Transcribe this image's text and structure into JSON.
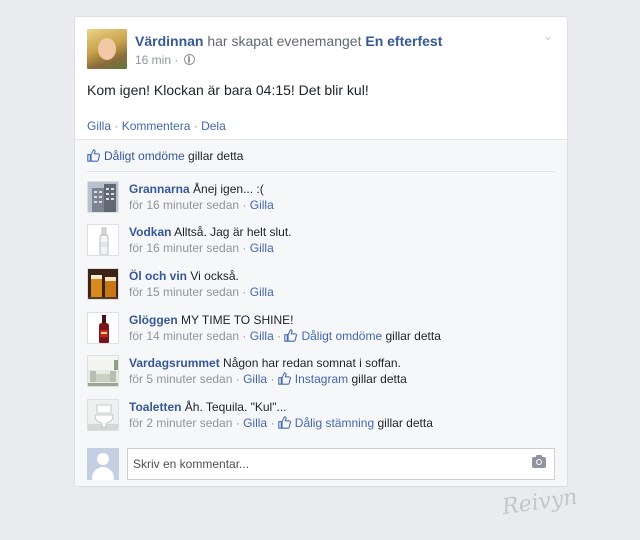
{
  "post": {
    "author": "Värdinnan",
    "action_text": "har skapat evenemanget",
    "event_name": "En efterfest",
    "time": "16 min",
    "text": "Kom igen! Klockan är bara 04:15! Det blir kul!",
    "actions": {
      "like": "Gilla",
      "comment": "Kommentera",
      "share": "Dela"
    },
    "separator": "·"
  },
  "likes": {
    "liker": "Dåligt omdöme",
    "suffix": "gillar detta"
  },
  "comments": [
    {
      "name": "Grannarna",
      "text": "Ånej igen... :(",
      "time": "för 16 minuter sedan",
      "like": "Gilla",
      "icon": "building-icon"
    },
    {
      "name": "Vodkan",
      "text": "Alltså. Jag är helt slut.",
      "time": "för 16 minuter sedan",
      "like": "Gilla",
      "icon": "vodka-bottle-icon"
    },
    {
      "name": "Öl och vin",
      "text": "Vi också.",
      "time": "för 15 minuter sedan",
      "like": "Gilla",
      "icon": "beer-glasses-icon"
    },
    {
      "name": "Glöggen",
      "text": "MY TIME TO SHINE!",
      "time": "för 14 minuter sedan",
      "like": "Gilla",
      "icon": "glogg-bottle-icon",
      "liked_by": "Dåligt omdöme",
      "liked_suffix": "gillar detta"
    },
    {
      "name": "Vardagsrummet",
      "text": "Någon har redan somnat i soffan.",
      "time": "för 5 minuter sedan",
      "like": "Gilla",
      "icon": "living-room-icon",
      "liked_by": "Instagram",
      "liked_suffix": "gillar detta"
    },
    {
      "name": "Toaletten",
      "text": "Åh. Tequila. \"Kul\"...",
      "time": "för 2 minuter sedan",
      "like": "Gilla",
      "icon": "toilet-icon",
      "liked_by": "Dålig stämning",
      "liked_suffix": "gillar detta"
    }
  ],
  "reply": {
    "placeholder": "Skriv en kommentar..."
  },
  "signature": "Reivyn",
  "colors": {
    "link": "#365899",
    "action": "#4267b2",
    "muted": "#90949c",
    "background": "#e9ebee"
  }
}
